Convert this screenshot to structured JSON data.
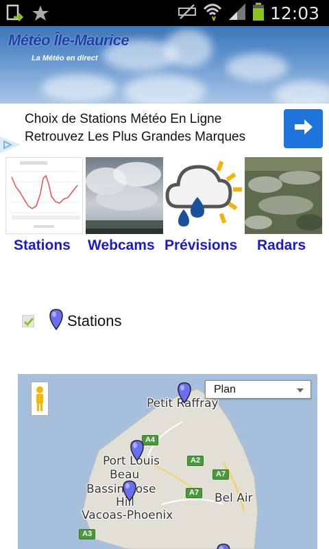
{
  "statusbar": {
    "time": "12:03",
    "icons": [
      "screenshot-icon",
      "star-icon",
      "mute-icon",
      "wifi-icon",
      "signal-icon",
      "battery-icon"
    ]
  },
  "header": {
    "title": "Météo Île-Maurice",
    "subtitle": "La Météo en direct"
  },
  "ad": {
    "line1": "Choix de Stations Météo En Ligne",
    "line2": "Retrouvez Les Plus Grandes Marques",
    "button_icon": "arrow-right-icon"
  },
  "categories": [
    {
      "label": "Stations",
      "icon": "station-chart-thumbnail"
    },
    {
      "label": "Webcams",
      "icon": "clouds-photo-thumbnail"
    },
    {
      "label": "Prévisions",
      "icon": "weather-forecast-icon"
    },
    {
      "label": "Radars",
      "icon": "satellite-image-thumbnail"
    }
  ],
  "layer": {
    "label": "Stations",
    "checked": true
  },
  "map": {
    "map_type": "Plan",
    "places": [
      "Petit Raffray",
      "Port Louis",
      "Beau",
      "Bassin Rose",
      "Hill",
      "Vacoas-Phoenix",
      "Bel Air"
    ],
    "roads": [
      "A4",
      "A2",
      "A7",
      "A7",
      "A3"
    ]
  },
  "colors": {
    "accent_link": "#1a1ad0",
    "ad_button": "#1e74dd",
    "header_title": "#1e3fa8",
    "map_sea": "#a5bfdd",
    "map_land": "#e2dfd6"
  }
}
